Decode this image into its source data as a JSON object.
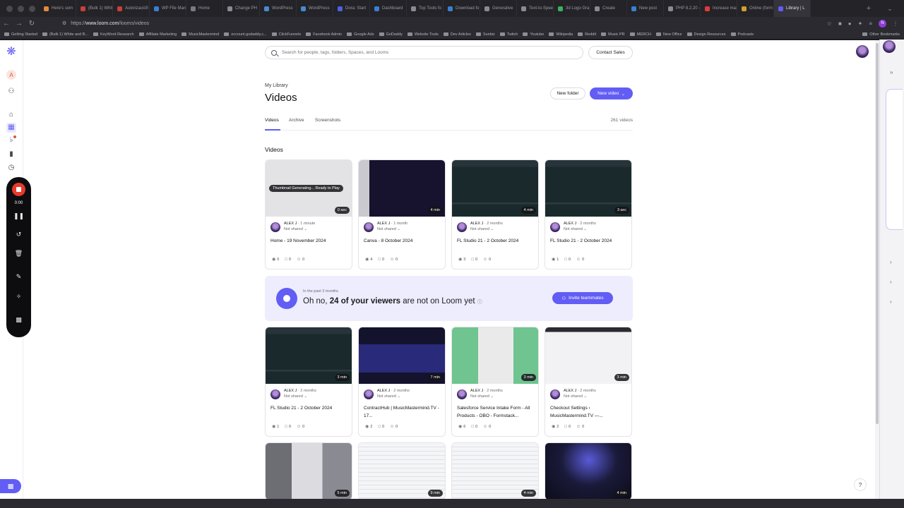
{
  "browser": {
    "tabs": [
      {
        "label": "Here's som",
        "color": "#e58a3a"
      },
      {
        "label": "(Bulk 1) White and B",
        "color": "#c7403a"
      },
      {
        "label": "Autorizacióñ",
        "color": "#c7403a"
      },
      {
        "label": "WP File Manager",
        "color": "#3a7fd0"
      },
      {
        "label": "Home",
        "color": "#7a7a84"
      },
      {
        "label": "Change PH",
        "color": "#8a8a94"
      },
      {
        "label": "WordPress",
        "color": "#4a8ad0"
      },
      {
        "label": "WordPress",
        "color": "#4a8ad0"
      },
      {
        "label": "Dora: Start",
        "color": "#5060e0"
      },
      {
        "label": "Dashboard",
        "color": "#3a7fd0"
      },
      {
        "label": "Top Tools fo",
        "color": "#8a8a94"
      },
      {
        "label": "Download fo",
        "color": "#3a7fd0"
      },
      {
        "label": "Generative",
        "color": "#8a8a94"
      },
      {
        "label": "Text-to-Spee",
        "color": "#8a8a94"
      },
      {
        "label": "3d Logo Gra",
        "color": "#3ab060"
      },
      {
        "label": "Create",
        "color": "#8a8a94"
      },
      {
        "label": "New post",
        "color": "#3a7fd0"
      },
      {
        "label": "PHP 8.2.20 - php",
        "color": "#8a8a94"
      },
      {
        "label": "Increase max",
        "color": "#e03a3a"
      },
      {
        "label": "Online (form",
        "color": "#d0a030"
      },
      {
        "label": "Library | L",
        "color": "#625df5",
        "active": true
      }
    ],
    "url_prefix": "https://",
    "url_host": "www.loom.com",
    "url_path": "/looms/videos",
    "bookmarks": [
      "Getting Started",
      "(Bulk 1) White and B...",
      "KeyWord Research",
      "Affiliate Marketing",
      "MusicMastermind",
      "eccount.godaddy.c...",
      "ClickFunnels",
      "Facebook Admin",
      "Google Ads",
      "GoDaddy",
      "Website Tools",
      "Dev Articles",
      "Sunbiz",
      "Twitch",
      "Youtube",
      "Wikipedia",
      "Reddit",
      "Music PR",
      "MERCH",
      "New Office",
      "Design Resources",
      "Podcasts"
    ],
    "other_bookmarks": "Other Bookmarks",
    "profile_initial": "N"
  },
  "sidebar": {
    "avatar_initial": "A"
  },
  "recorder": {
    "time": "0:00"
  },
  "search": {
    "placeholder": "Search for people, tags, folders, Spaces, and Looms"
  },
  "header": {
    "contact_sales": "Contact Sales",
    "breadcrumb": "My Library",
    "title": "Videos",
    "new_folder": "New folder",
    "new_video": "New video"
  },
  "tabs": {
    "videos": "Videos",
    "archive": "Archive",
    "screenshots": "Screenshots",
    "count": "261 videos"
  },
  "section_title": "Videos",
  "banner": {
    "small": "In the past 3 months",
    "prefix": "Oh no, ",
    "bold": "24 of your viewers",
    "suffix": " are not on Loom yet",
    "invite": "Invite teammates"
  },
  "videos_row1": [
    {
      "author": "ALEX J",
      "ago": "1 minute",
      "share": "Not shared",
      "title": "Home - 19 November 2024",
      "duration": "0 sec",
      "views": "0",
      "comments": "0",
      "reactions": "0",
      "overlay": "Thumbnail Generating... Ready to Play",
      "thumb": "generating"
    },
    {
      "author": "ALEX J",
      "ago": "1 month",
      "share": "Not shared",
      "title": "Canva - 8 October 2024",
      "duration": "4 min",
      "views": "4",
      "comments": "0",
      "reactions": "0",
      "thumb": "canva"
    },
    {
      "author": "ALEX J",
      "ago": "2 months",
      "share": "Not shared",
      "title": "FL Studio 21 - 2 October 2024",
      "duration": "4 min",
      "views": "3",
      "comments": "0",
      "reactions": "0",
      "thumb": "fl"
    },
    {
      "author": "ALEX J",
      "ago": "2 months",
      "share": "Not shared",
      "title": "FL Studio 21 - 2 October 2024",
      "duration": "3 sec",
      "views": "1",
      "comments": "0",
      "reactions": "0",
      "thumb": "fl"
    }
  ],
  "videos_row2": [
    {
      "author": "ALEX J",
      "ago": "2 months",
      "share": "Not shared",
      "title": "FL Studio 21 - 2 October 2024",
      "duration": "3 min",
      "views": "1",
      "comments": "0",
      "reactions": "0",
      "thumb": "fl"
    },
    {
      "author": "ALEX J",
      "ago": "2 months",
      "share": "Not shared",
      "title": "ContractHub | MusicMastermind.TV - 17...",
      "duration": "7 min",
      "views": "2",
      "comments": "0",
      "reactions": "0",
      "thumb": "contract"
    },
    {
      "author": "ALEX J",
      "ago": "2 months",
      "share": "Not shared",
      "title": "Salesforce Service Intake Form - All Products - OBO - Formstack...",
      "duration": "3 min",
      "views": "6",
      "comments": "0",
      "reactions": "0",
      "thumb": "form"
    },
    {
      "author": "ALEX J",
      "ago": "2 months",
      "share": "Not shared",
      "title": "Checkout Settings ‹ MusicMastermind.TV —...",
      "duration": "3 min",
      "views": "2",
      "comments": "0",
      "reactions": "0",
      "thumb": "checkout"
    }
  ],
  "videos_row3": [
    {
      "duration": "5 min",
      "thumb": "gray"
    },
    {
      "duration": "9 min",
      "thumb": "sheet"
    },
    {
      "duration": "4 min",
      "thumb": "sheet"
    },
    {
      "duration": "4 min",
      "thumb": "night"
    }
  ],
  "icons": {
    "logo": "loom-logo-icon",
    "members": "members-icon",
    "home": "home-icon",
    "library": "library-icon",
    "notifications": "bell-icon",
    "watch_later": "bookmark-icon",
    "history": "clock-icon"
  },
  "colors": {
    "accent": "#625df5",
    "record": "#e8392c",
    "banner_bg": "#eeedfd"
  }
}
